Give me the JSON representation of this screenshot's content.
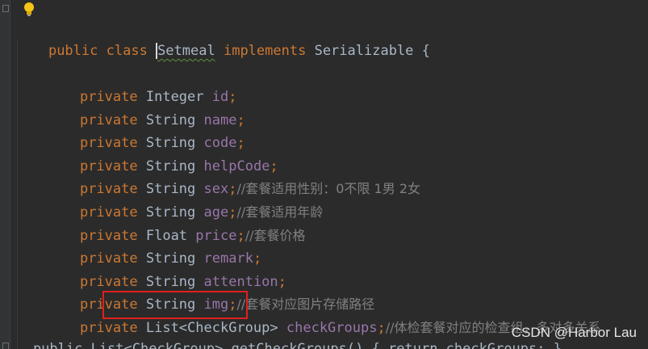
{
  "editor": {
    "class_decl": {
      "kw_public": "public",
      "kw_class": "class",
      "class_name": "Setmeal",
      "kw_implements": "implements",
      "iface": "Serializable",
      "brace": "{"
    },
    "fields": [
      {
        "mod": "private",
        "type": "Integer",
        "name": "id",
        "semi": ";",
        "comment": ""
      },
      {
        "mod": "private",
        "type": "String",
        "name": "name",
        "semi": ";",
        "comment": ""
      },
      {
        "mod": "private",
        "type": "String",
        "name": "code",
        "semi": ";",
        "comment": ""
      },
      {
        "mod": "private",
        "type": "String",
        "name": "helpCode",
        "semi": ";",
        "comment": ""
      },
      {
        "mod": "private",
        "type": "String",
        "name": "sex",
        "semi": ";",
        "comment": "//套餐适用性别：0不限 1男 2女"
      },
      {
        "mod": "private",
        "type": "String",
        "name": "age",
        "semi": ";",
        "comment": "//套餐适用年龄"
      },
      {
        "mod": "private",
        "type": "Float",
        "name": "price",
        "semi": ";",
        "comment": "//套餐价格"
      },
      {
        "mod": "private",
        "type": "String",
        "name": "remark",
        "semi": ";",
        "comment": ""
      },
      {
        "mod": "private",
        "type": "String",
        "name": "attention",
        "semi": ";",
        "comment": ""
      },
      {
        "mod": "private",
        "type": "String",
        "name": "img",
        "semi": ";",
        "comment": "//套餐对应图片存储路径"
      },
      {
        "mod": "private",
        "type": "List<CheckGroup>",
        "name": "checkGroups",
        "semi": ";",
        "comment": "//体检套餐对应的检查组，多对多关系"
      }
    ],
    "partial_line": "    public List<CheckGroup> getCheckGroups() { return checkGroups; }"
  },
  "watermark": "CSDN @Harbor Lau",
  "colors": {
    "background": "#2b2b2b",
    "keyword": "#cc7832",
    "field": "#9876aa",
    "comment": "#808080",
    "text": "#a9b7c6",
    "highlight_box": "#e0201d"
  },
  "icons": {
    "intention_bulb": "lightbulb-icon"
  }
}
